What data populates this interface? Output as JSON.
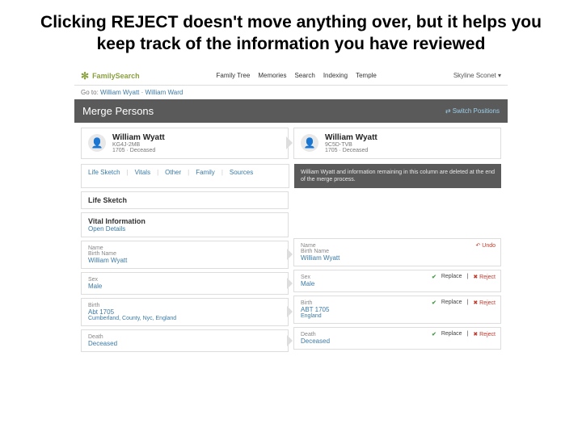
{
  "slide_title": "Clicking REJECT doesn't move anything over, but it helps you keep track of the information you have reviewed",
  "brand": {
    "name": "FamilySearch"
  },
  "nav": {
    "i0": "Family Tree",
    "i1": "Memories",
    "i2": "Search",
    "i3": "Indexing",
    "i4": "Temple"
  },
  "user_menu": "Skyline Sconet ▾",
  "breadcrumb": {
    "goto": "Go to:",
    "name": "William Wyatt",
    "alt": "William Ward"
  },
  "header": {
    "title": "Merge Persons",
    "switch": "Switch Positions"
  },
  "left": {
    "name": "William Wyatt",
    "id": "KG4J-2MB",
    "status": "1705 · Deceased"
  },
  "right": {
    "name": "William Wyatt",
    "id": "9C5D-TVB",
    "status": "1705 · Deceased"
  },
  "tabs": {
    "t0": "Life Sketch",
    "t1": "Vitals",
    "t2": "Other",
    "t3": "Family",
    "t4": "Sources"
  },
  "note": "William Wyatt and information remaining in this column are deleted at the end of the merge process.",
  "sections": {
    "life_sketch": "Life Sketch",
    "vital": "Vital Information",
    "open": "Open Details"
  },
  "fields": {
    "name_label": "Name",
    "birthname_label": "Birth Name",
    "sex_label": "Sex",
    "birth_label": "Birth",
    "death_label": "Death"
  },
  "leftData": {
    "birthname": "William Wyatt",
    "sex": "Male",
    "birth": "Abt 1705",
    "birthplace": "Cumberland, County, Nyc, England",
    "death": "Deceased"
  },
  "rightData": {
    "birthname": "William Wyatt",
    "sex": "Male",
    "birth": "ABT 1705",
    "birthplace": "England",
    "death": "Deceased"
  },
  "actions": {
    "replace": "Replace",
    "reject": "Reject",
    "undo": "Undo"
  }
}
